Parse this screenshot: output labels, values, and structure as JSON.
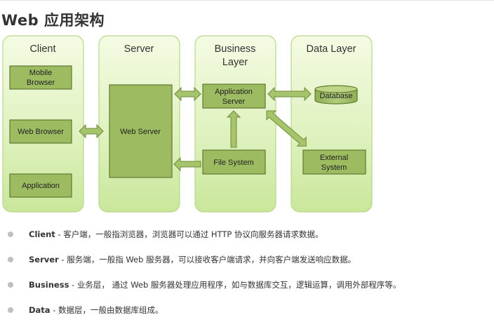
{
  "page": {
    "title": "Web 应用架构"
  },
  "diagram": {
    "columns": {
      "client": "Client",
      "server": "Server",
      "business_line1": "Business",
      "business_line2": "Layer",
      "data": "Data Layer"
    },
    "nodes": {
      "mobile_browser_line1": "Mobile",
      "mobile_browser_line2": "Browser",
      "web_browser": "Web Browser",
      "application": "Application",
      "web_server": "Web Server",
      "app_server_line1": "Application",
      "app_server_line2": "Server",
      "file_system": "File System",
      "database": "Database",
      "external_line1": "External",
      "external_line2": "System"
    },
    "colors": {
      "column_fill_top": "#f4fbe3",
      "column_fill_bottom": "#c9e79b",
      "column_stroke": "#b7d78a",
      "node_fill": "#9dbb61",
      "node_stroke": "#5f7a2e",
      "arrow_fill": "#a6c46c"
    }
  },
  "descriptions": [
    {
      "term": "Client",
      "text": " - 客户端，一般指浏览器，浏览器可以通过 HTTP 协议向服务器请求数据。"
    },
    {
      "term": "Server",
      "text": " - 服务端，一般指 Web 服务器，可以接收客户端请求，并向客户端发送响应数据。"
    },
    {
      "term": "Business",
      "text": " - 业务层， 通过 Web 服务器处理应用程序，如与数据库交互，逻辑运算，调用外部程序等。"
    },
    {
      "term": "Data",
      "text": " - 数据层，一般由数据库组成。"
    }
  ]
}
